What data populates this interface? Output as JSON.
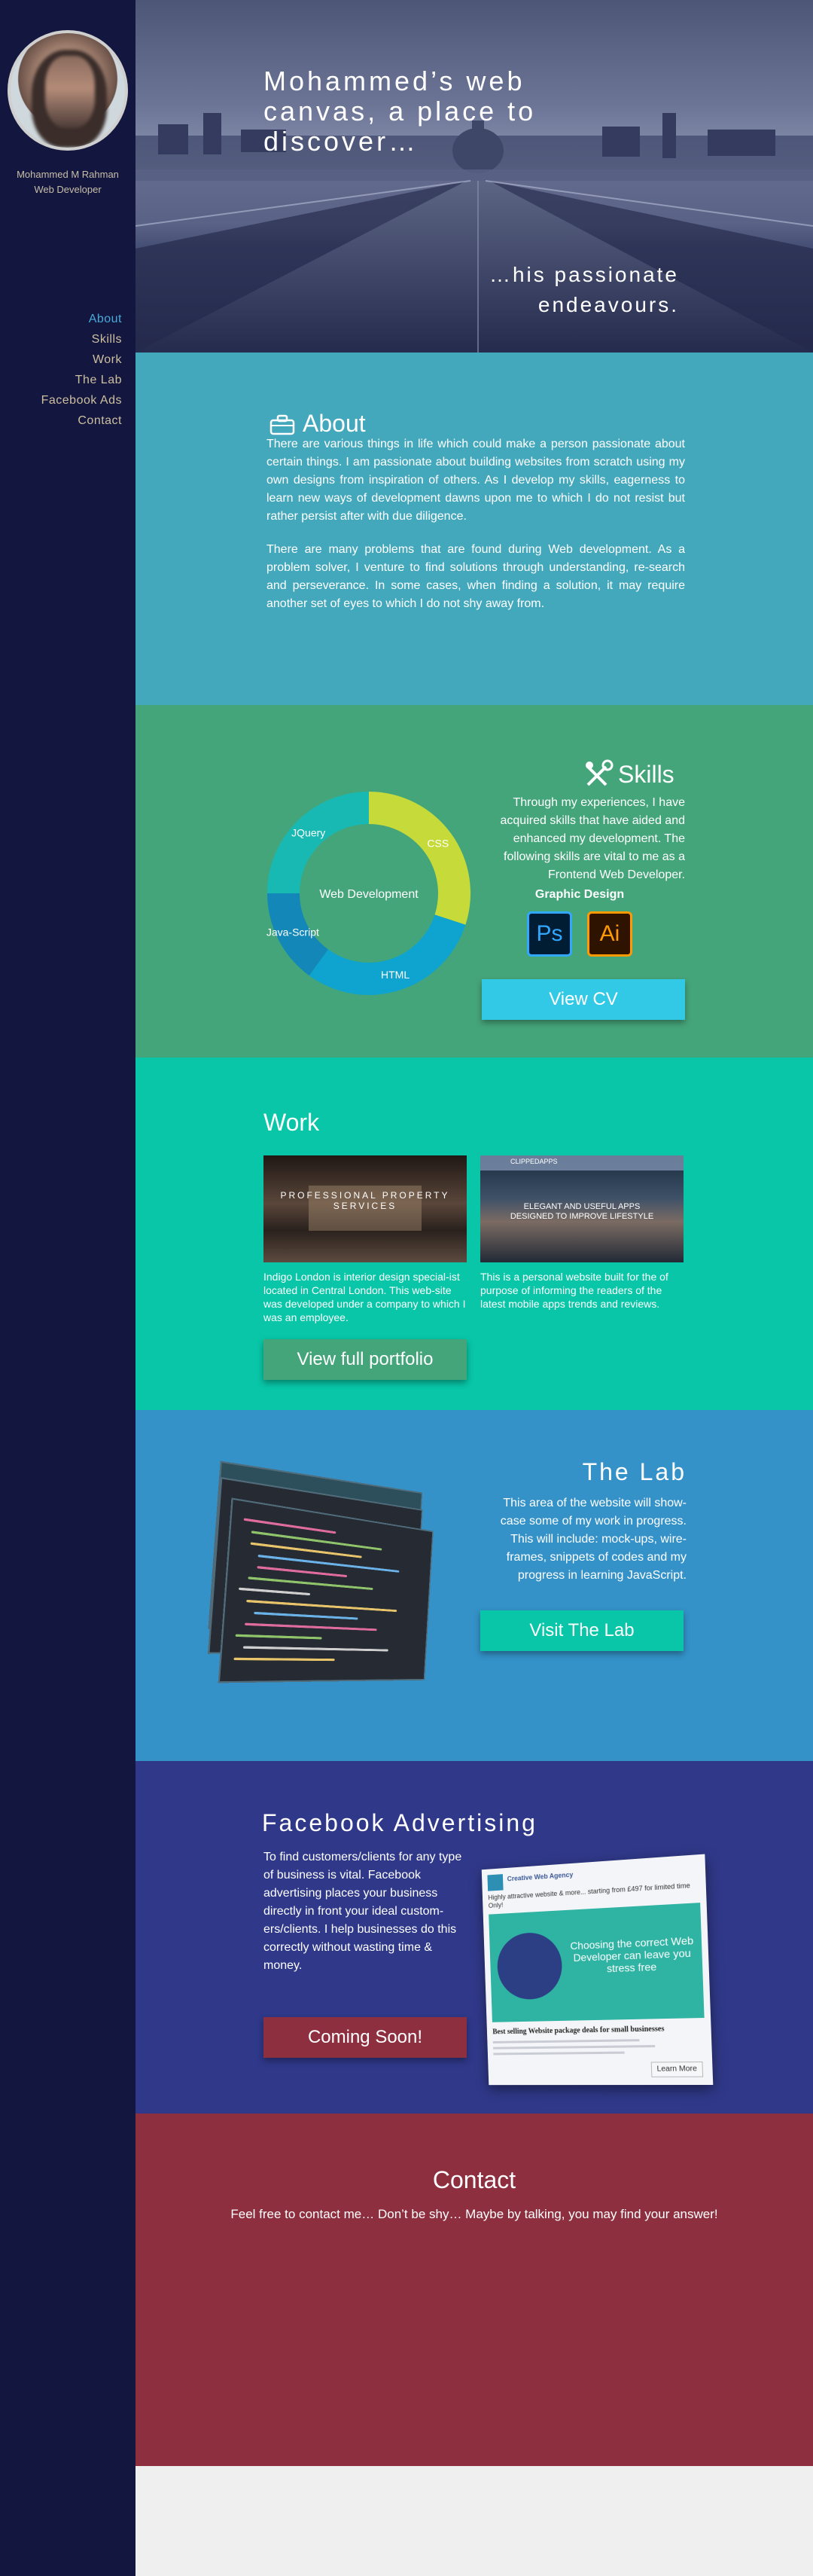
{
  "sidebar": {
    "name": "Mohammed M Rahman",
    "role": "Web Developer",
    "nav": [
      "About",
      "Skills",
      "Work",
      "The Lab",
      "Facebook Ads",
      "Contact"
    ]
  },
  "hero": {
    "title": "Mohammed’s web canvas, a place to discover…",
    "tagline": "…his passionate endeavours."
  },
  "about": {
    "heading": "About",
    "paragraph1": "There are various things in life which could make a person passionate about certain things. I am passionate about building websites from scratch using my own designs from inspiration of others. As I develop my skills, eagerness to learn new ways of development dawns upon me to which I do not resist but rather persist after with due diligence.",
    "paragraph2": "There are many problems that are found during Web development. As a problem solver, I venture to find solutions through understanding, re-search and perseverance. In some cases, when finding a solution, it may require another set of eyes to which I do not shy away from."
  },
  "skills": {
    "heading": "Skills",
    "text": "Through my experiences, I have acquired skills that have aided and enhanced my development. The following skills are vital to me as a Frontend Web Developer.",
    "graphic_heading": "Graphic Design",
    "ps_label": "Ps",
    "ai_label": "Ai",
    "cv_button": "View CV",
    "chart_center": "Web Development"
  },
  "chart_data": {
    "type": "pie",
    "categories": [
      "CSS",
      "HTML",
      "Java-Script",
      "JQuery"
    ],
    "values": [
      30,
      30,
      15,
      25
    ],
    "colors": [
      "#c6db3a",
      "#0fa3cf",
      "#1387b8",
      "#18b9b2"
    ],
    "title": "Web Development"
  },
  "work": {
    "heading": "Work",
    "thumb1_text": "PROFESSIONAL PROPERTY SERVICES",
    "thumb2_text": "ELEGANT AND USEFUL APPS DESIGNED TO IMPROVE LIFESTYLE",
    "thumb2_brand": "CLIPPEDAPPS",
    "desc1": "Indigo London is interior design special-ist located in Central London. This web-site was developed under a company to which I was an employee.",
    "desc2": "This is a personal website built for the of purpose of informing the readers of the latest mobile apps trends and reviews.",
    "portfolio_button": "View full portfolio"
  },
  "lab": {
    "heading": "The Lab",
    "text": "This area of the website will show-case some of my work in progress. This will include: mock-ups, wire-frames, snippets of codes and my progress in learning JavaScript.",
    "button": "Visit The Lab"
  },
  "facebook": {
    "heading": "Facebook Advertising",
    "text": "To find customers/clients for any type of business is vital. Facebook advertising places your business directly in front your ideal custom-ers/clients. I help businesses do this correctly without wasting time & money.",
    "button": "Coming Soon!",
    "ad_page": "Creative Web Agency",
    "ad_intro": "Highly attractive website & more... starting from £497 for limited time Only!",
    "ad_headline": "Choosing the correct Web Developer can leave you stress free",
    "ad_title": "Best selling Website package deals for small businesses",
    "ad_cta": "Learn More"
  },
  "contact": {
    "heading": "Contact",
    "text": "Feel free to contact me… Don’t be shy… Maybe by talking, you may find your answer!"
  }
}
